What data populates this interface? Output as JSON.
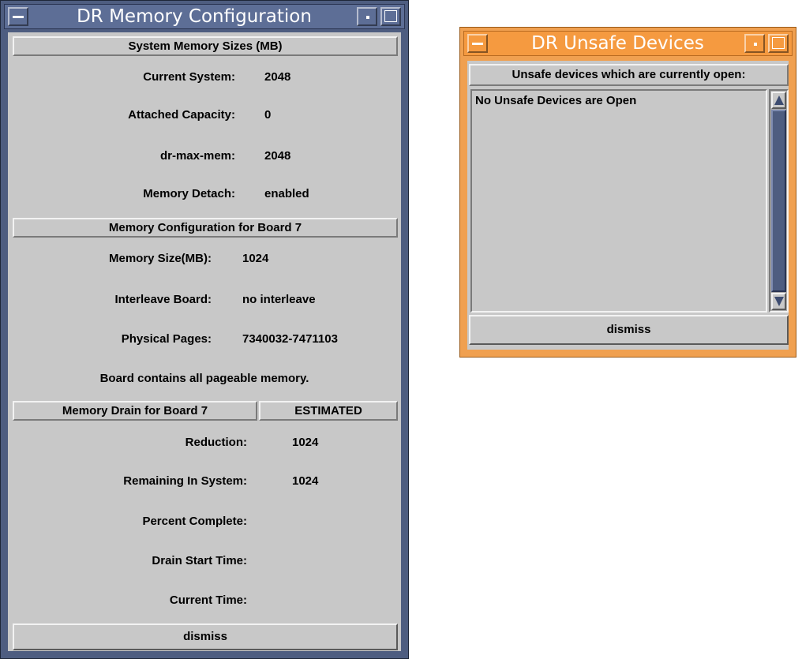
{
  "memory_window": {
    "title": "DR Memory Configuration",
    "system_section": {
      "header": "System Memory Sizes (MB)",
      "rows": [
        {
          "label": "Current System:",
          "value": "2048"
        },
        {
          "label": "Attached Capacity:",
          "value": "0"
        },
        {
          "label": "dr-max-mem:",
          "value": "2048"
        },
        {
          "label": "Memory Detach:",
          "value": "enabled"
        }
      ]
    },
    "board_section": {
      "header": "Memory Configuration for Board  7",
      "rows": [
        {
          "label": "Memory Size(MB):",
          "value": "1024"
        },
        {
          "label": "Interleave Board:",
          "value": "no interleave"
        },
        {
          "label": "Physical Pages:",
          "value": "7340032-7471103"
        }
      ],
      "note": "Board contains all pageable memory."
    },
    "drain_section": {
      "header": "Memory Drain for Board 7",
      "status": "ESTIMATED",
      "rows": [
        {
          "label": "Reduction:",
          "value": "1024"
        },
        {
          "label": "Remaining In System:",
          "value": "1024"
        },
        {
          "label": "Percent Complete:",
          "value": ""
        },
        {
          "label": "Drain Start Time:",
          "value": ""
        },
        {
          "label": "Current Time:",
          "value": ""
        }
      ]
    },
    "dismiss_label": "dismiss"
  },
  "unsafe_window": {
    "title": "DR Unsafe Devices",
    "header": "Unsafe devices which are currently open:",
    "items": [
      "No Unsafe Devices are Open"
    ],
    "dismiss_label": "dismiss"
  },
  "colors": {
    "memory_frame": "#4e5d80",
    "unsafe_frame": "#f0a050",
    "panel_gray": "#c8c8c8"
  },
  "icons": [
    "window-menu-icon",
    "minimize-icon",
    "maximize-icon",
    "scroll-up-arrow-icon",
    "scroll-down-arrow-icon"
  ]
}
